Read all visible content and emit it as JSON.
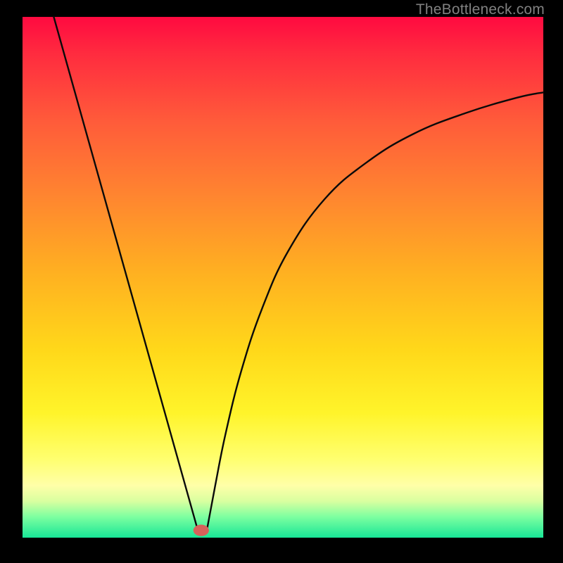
{
  "watermark": "TheBottleneck.com",
  "chart_data": {
    "type": "line",
    "title": "",
    "xlabel": "",
    "ylabel": "",
    "xlim": [
      0,
      100
    ],
    "ylim": [
      0,
      100
    ],
    "curve": {
      "left_line": {
        "x1": 6,
        "y1": 100,
        "x2": 33.5,
        "y2": 2
      },
      "vertex": {
        "x": 34,
        "y": 2
      },
      "flat": {
        "x1": 33.5,
        "x2": 35.5,
        "y": 2
      },
      "right_curve": [
        {
          "x": 35.5,
          "y": 2
        },
        {
          "x": 37,
          "y": 10
        },
        {
          "x": 39,
          "y": 20
        },
        {
          "x": 42,
          "y": 32
        },
        {
          "x": 46,
          "y": 44
        },
        {
          "x": 51,
          "y": 55
        },
        {
          "x": 58,
          "y": 65
        },
        {
          "x": 66,
          "y": 72
        },
        {
          "x": 75,
          "y": 77.5
        },
        {
          "x": 85,
          "y": 81.5
        },
        {
          "x": 95,
          "y": 84.5
        },
        {
          "x": 100,
          "y": 85.5
        }
      ]
    },
    "marker": {
      "x": 34.3,
      "y": 1.4,
      "rx": 1.5,
      "ry": 1.1,
      "color": "#d6625a"
    },
    "background": {
      "gradient": [
        "#ff0a40",
        "#ff2b3f",
        "#ff5b3a",
        "#ff8430",
        "#ffb021",
        "#ffd81a",
        "#fff42a",
        "#ffff70",
        "#ffffa8",
        "#d9ffa0",
        "#7dffa0",
        "#17e697"
      ]
    }
  }
}
